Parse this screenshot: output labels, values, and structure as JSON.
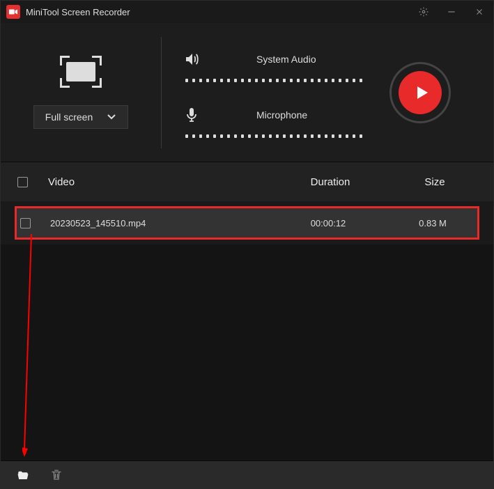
{
  "app": {
    "title": "MiniTool Screen Recorder"
  },
  "region": {
    "mode_label": "Full screen"
  },
  "audio": {
    "system_label": "System Audio",
    "mic_label": "Microphone"
  },
  "table": {
    "header_video": "Video",
    "header_duration": "Duration",
    "header_size": "Size",
    "rows": [
      {
        "name": "20230523_145510.mp4",
        "duration": "00:00:12",
        "size": "0.83 M"
      }
    ]
  }
}
